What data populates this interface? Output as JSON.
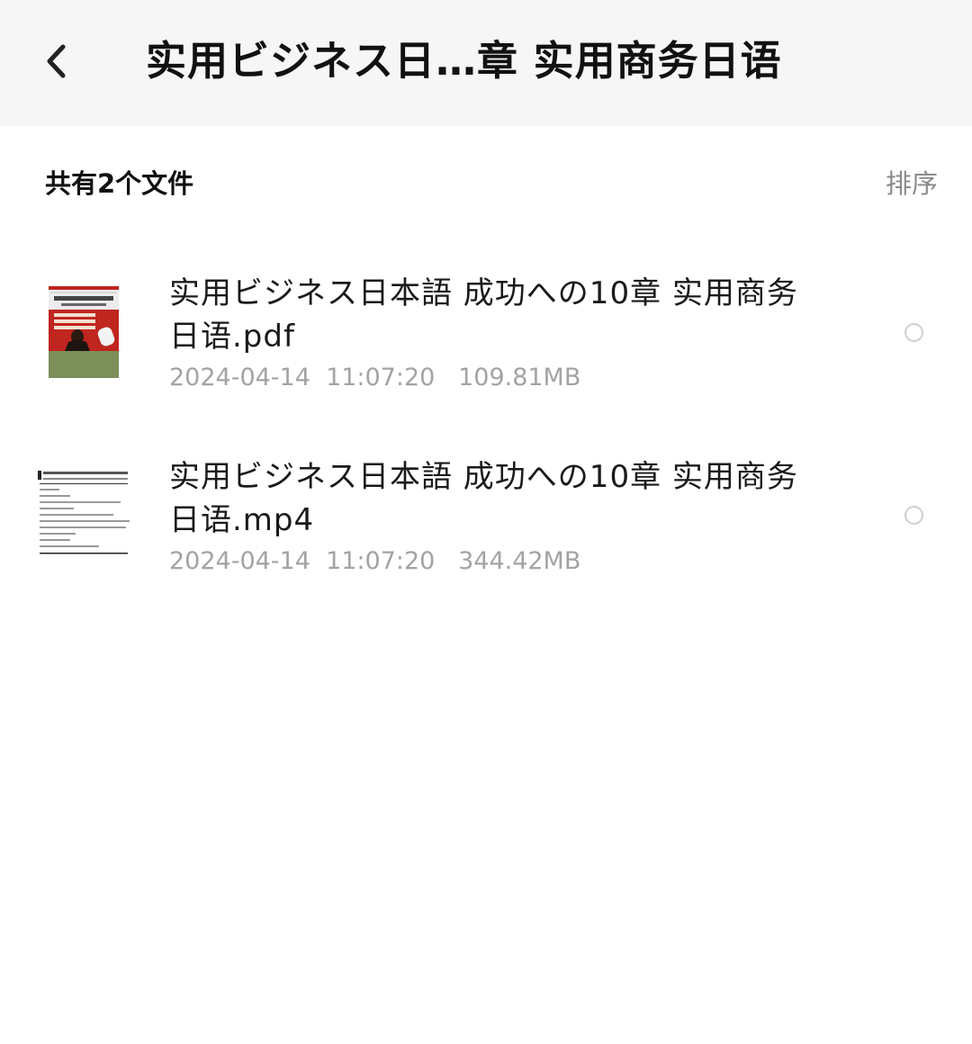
{
  "header": {
    "back_icon": "chevron-left-icon",
    "title": "实用ビジネス日…章 实用商务日语"
  },
  "toolbar": {
    "count_label": "共有2个文件",
    "sort_label": "排序"
  },
  "files": [
    {
      "name_line1": "实用ビジネス日本語 成功への10章 实用商务",
      "name_line2": "日语.pdf",
      "meta": "2024-04-14  11:07:20   109.81MB",
      "thumbnail": "pdf-book-cover",
      "selected": false
    },
    {
      "name_line1": "实用ビジネス日本語 成功への10章 实用商务",
      "name_line2": "日语.mp4",
      "meta": "2024-04-14  11:07:20   344.42MB",
      "thumbnail": "video-document-page",
      "selected": false
    }
  ],
  "colors": {
    "header_bg": "#f6f6f6",
    "text_primary": "#1a1a1a",
    "text_secondary": "#a3a3a3",
    "sort_text": "#8a8a8a",
    "radio_border": "#cfcfcf",
    "cover_red": "#c0251f",
    "cover_green": "#7d8f5a"
  }
}
